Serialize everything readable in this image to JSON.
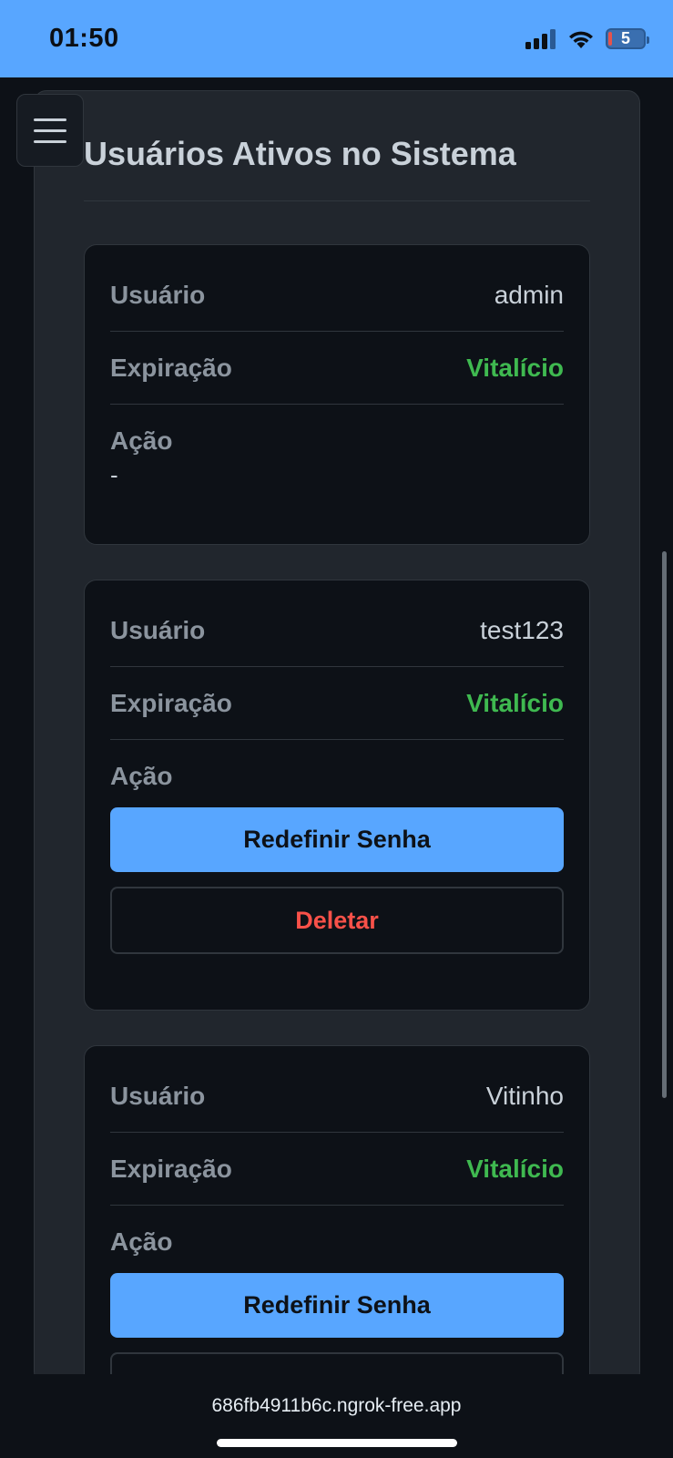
{
  "status_bar": {
    "time": "01:50",
    "battery": "5"
  },
  "page": {
    "title": "Usuários Ativos no Sistema"
  },
  "labels": {
    "user": "Usuário",
    "expiration": "Expiração",
    "action": "Ação"
  },
  "users": [
    {
      "username": "admin",
      "expiration": "Vitalício",
      "action_text": "-"
    },
    {
      "username": "test123",
      "expiration": "Vitalício",
      "reset_label": "Redefinir Senha",
      "delete_label": "Deletar"
    },
    {
      "username": "Vitinho",
      "expiration": "Vitalício",
      "reset_label": "Redefinir Senha"
    }
  ],
  "browser": {
    "url": "686fb4911b6c.ngrok-free.app"
  },
  "colors": {
    "accent": "#58a6ff",
    "success": "#3fb950",
    "danger": "#f85149",
    "background": "#0d1117",
    "panel": "#21262d"
  }
}
